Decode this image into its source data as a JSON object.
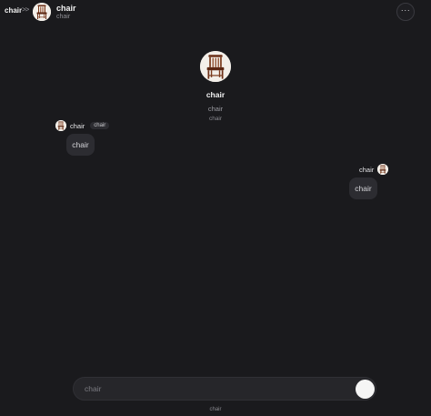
{
  "header": {
    "brand": "chair",
    "separator": ">>",
    "character_name": "chair",
    "character_subtitle": "chair",
    "more_label": "···"
  },
  "profile": {
    "name": "chair",
    "description": "chair",
    "meta": "chair"
  },
  "messages": [
    {
      "sender": "chair",
      "tag": "chair",
      "text": "chair",
      "side": "left"
    },
    {
      "sender": "chair",
      "text": "chair",
      "side": "right"
    }
  ],
  "composer": {
    "placeholder": "chair"
  },
  "footer": {
    "note": "chair"
  },
  "colors": {
    "background": "#1a1a1d",
    "bubble": "#2c2c31",
    "send_button": "#f5f5f5"
  }
}
